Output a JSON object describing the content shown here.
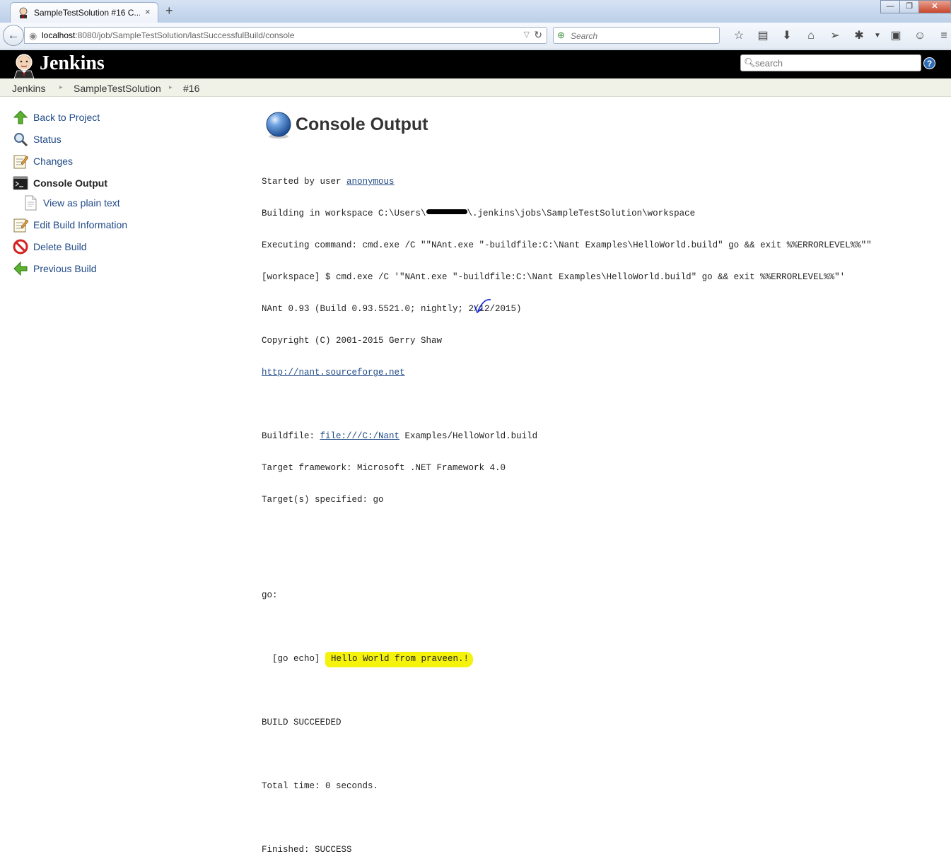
{
  "browser": {
    "tab_title": "SampleTestSolution #16 C...",
    "tab_close": "×",
    "new_tab": "+",
    "window_buttons": [
      "—",
      "❐",
      "✕"
    ],
    "url_host": "localhost",
    "url_path": ":8080/job/SampleTestSolution/lastSuccessfulBuild/console",
    "search_placeholder": "Search",
    "toolbar_icons": [
      "star-icon",
      "reading-list-icon",
      "download-icon",
      "home-icon",
      "send-icon",
      "bug-icon",
      "menu-dropdown-icon",
      "notes-icon",
      "smiley-icon",
      "hamburger-menu-icon"
    ]
  },
  "jenkins": {
    "brand": "Jenkins",
    "search_placeholder": "search",
    "help": "?"
  },
  "breadcrumbs": [
    {
      "label": "Jenkins"
    },
    {
      "label": "SampleTestSolution"
    },
    {
      "label": "#16"
    }
  ],
  "sidebar": {
    "items": [
      {
        "label": "Back to Project",
        "icon": "up-arrow-icon"
      },
      {
        "label": "Status",
        "icon": "magnifier-icon"
      },
      {
        "label": "Changes",
        "icon": "notepad-icon"
      },
      {
        "label": "Console Output",
        "icon": "terminal-icon",
        "active": true
      },
      {
        "label": "View as plain text",
        "icon": "document-icon"
      },
      {
        "label": "Edit Build Information",
        "icon": "notepad-icon"
      },
      {
        "label": "Delete Build",
        "icon": "no-entry-icon"
      },
      {
        "label": "Previous Build",
        "icon": "left-arrow-icon"
      }
    ]
  },
  "main": {
    "title": "Console Output",
    "console": {
      "started_by_prefix": "Started by user ",
      "started_by_user": "anonymous",
      "workspace_prefix": "Building in workspace C:\\Users\\",
      "workspace_suffix": "\\.jenkins\\jobs\\SampleTestSolution\\workspace",
      "exec_line": "Executing command: cmd.exe /C \"\"NAnt.exe \"-buildfile:C:\\Nant Examples\\HelloWorld.build\" go && exit %%ERRORLEVEL%%\"\"",
      "workspace_line": "[workspace] $ cmd.exe /C '\"NAnt.exe \"-buildfile:C:\\Nant Examples\\HelloWorld.build\" go && exit %%ERRORLEVEL%%\"'",
      "nant_version": "NAnt 0.93 (Build 0.93.5521.0; nightly; 2/12/2015)",
      "copyright": "Copyright (C) 2001-2015 Gerry Shaw",
      "nant_link": "http://nant.sourceforge.net",
      "buildfile_prefix": "Buildfile: ",
      "buildfile_link": "file:///C:/Nant",
      "buildfile_suffix": " Examples/HelloWorld.build",
      "target_framework": "Target framework: Microsoft .NET Framework 4.0",
      "targets_specified": "Target(s) specified: go",
      "go_label": "go:",
      "echo_prefix": "  [go echo] ",
      "echo_message": "Hello World from praveen.!",
      "build_result": "BUILD SUCCEEDED",
      "total_time": "Total time: 0 seconds.",
      "finished": "Finished: SUCCESS"
    }
  },
  "colors": {
    "header_bg": "#000000",
    "link": "#204a87",
    "highlight": "#f5f20c",
    "annotation": "#1a2bd1"
  }
}
